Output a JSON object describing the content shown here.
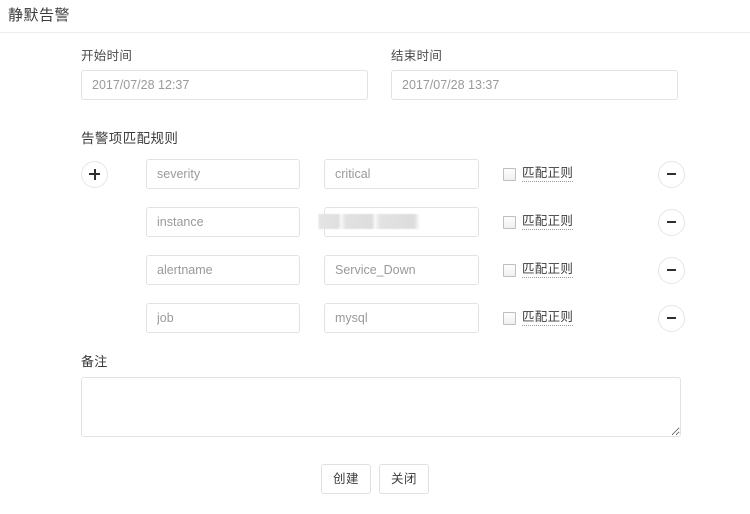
{
  "header": {
    "title": "静默告警"
  },
  "time_range": {
    "start": {
      "label": "开始时间",
      "value": "2017/07/28 12:37",
      "placeholder": "开始时间"
    },
    "end": {
      "label": "结束时间",
      "value": "2017/07/28 13:37",
      "placeholder": "结束时间"
    }
  },
  "rules": {
    "title": "告警项匹配规则",
    "add_label": "+",
    "remove_label": "−",
    "regex_label": "匹配正则",
    "items": [
      {
        "key": "severity",
        "value": "critical",
        "regex_label": "匹配正则",
        "regex_checked": false,
        "masked": false
      },
      {
        "key": "instance",
        "value": "1",
        "regex_label": "匹配正则",
        "regex_checked": false,
        "masked": true
      },
      {
        "key": "alertname",
        "value": "Service_Down",
        "regex_label": "匹配正则",
        "regex_checked": false,
        "masked": false
      },
      {
        "key": "job",
        "value": "mysql",
        "regex_label": "匹配正则",
        "regex_checked": false,
        "masked": false
      }
    ]
  },
  "remark": {
    "label": "备注",
    "value": "",
    "placeholder": ""
  },
  "footer": {
    "create_label": "创建",
    "close_label": "关闭"
  },
  "colors": {
    "page_background": "#ffffff",
    "border": "#e2e2e2",
    "text": "#3b3b3b",
    "muted_text": "#9a9a9a",
    "divider": "#ececec"
  }
}
